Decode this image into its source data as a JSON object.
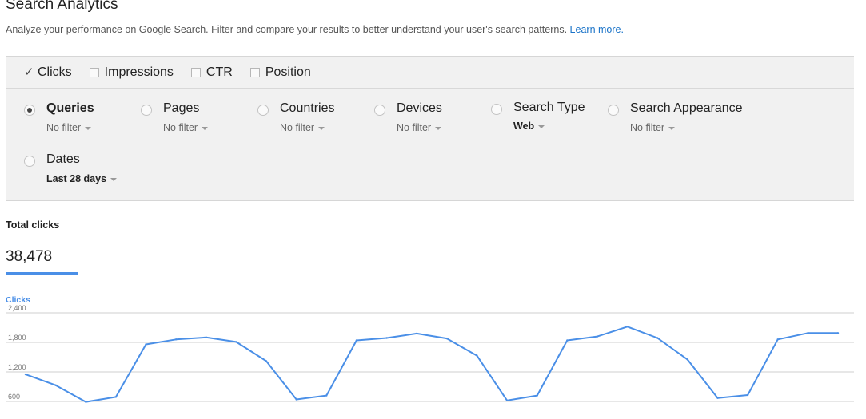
{
  "header": {
    "title": "Search Analytics",
    "description": "Analyze your performance on Google Search. Filter and compare your results to better understand your user's search patterns.",
    "learn_more": "Learn more."
  },
  "metrics": [
    {
      "label": "Clicks",
      "checked": true
    },
    {
      "label": "Impressions",
      "checked": false
    },
    {
      "label": "CTR",
      "checked": false
    },
    {
      "label": "Position",
      "checked": false
    }
  ],
  "dimensions": [
    {
      "label": "Queries",
      "filter": "No filter",
      "selected": true
    },
    {
      "label": "Pages",
      "filter": "No filter",
      "selected": false
    },
    {
      "label": "Countries",
      "filter": "No filter",
      "selected": false
    },
    {
      "label": "Devices",
      "filter": "No filter",
      "selected": false
    },
    {
      "label": "Search Type",
      "filter": "Web",
      "selected": false
    },
    {
      "label": "Search Appearance",
      "filter": "No filter",
      "selected": false
    },
    {
      "label": "Dates",
      "filter": "Last 28 days",
      "selected": false
    }
  ],
  "totals": {
    "label": "Total clicks",
    "value": "38,478"
  },
  "colors": {
    "accent": "#4a8fe7",
    "panel_bg": "#f1f1f1",
    "link": "#1a73c8"
  },
  "chart_data": {
    "type": "line",
    "series": [
      {
        "name": "Clicks",
        "values": [
          1150,
          930,
          590,
          690,
          1760,
          1860,
          1900,
          1810,
          1420,
          640,
          720,
          1840,
          1890,
          1980,
          1880,
          1530,
          620,
          720,
          1840,
          1920,
          2120,
          1890,
          1450,
          670,
          730,
          1860,
          1990,
          1990
        ]
      }
    ],
    "y_ticks": [
      "2,400",
      "1,800",
      "1,200",
      "600"
    ],
    "y_tick_values": [
      2400,
      1800,
      1200,
      600
    ],
    "ylim": [
      600,
      2400
    ],
    "grid": true
  }
}
